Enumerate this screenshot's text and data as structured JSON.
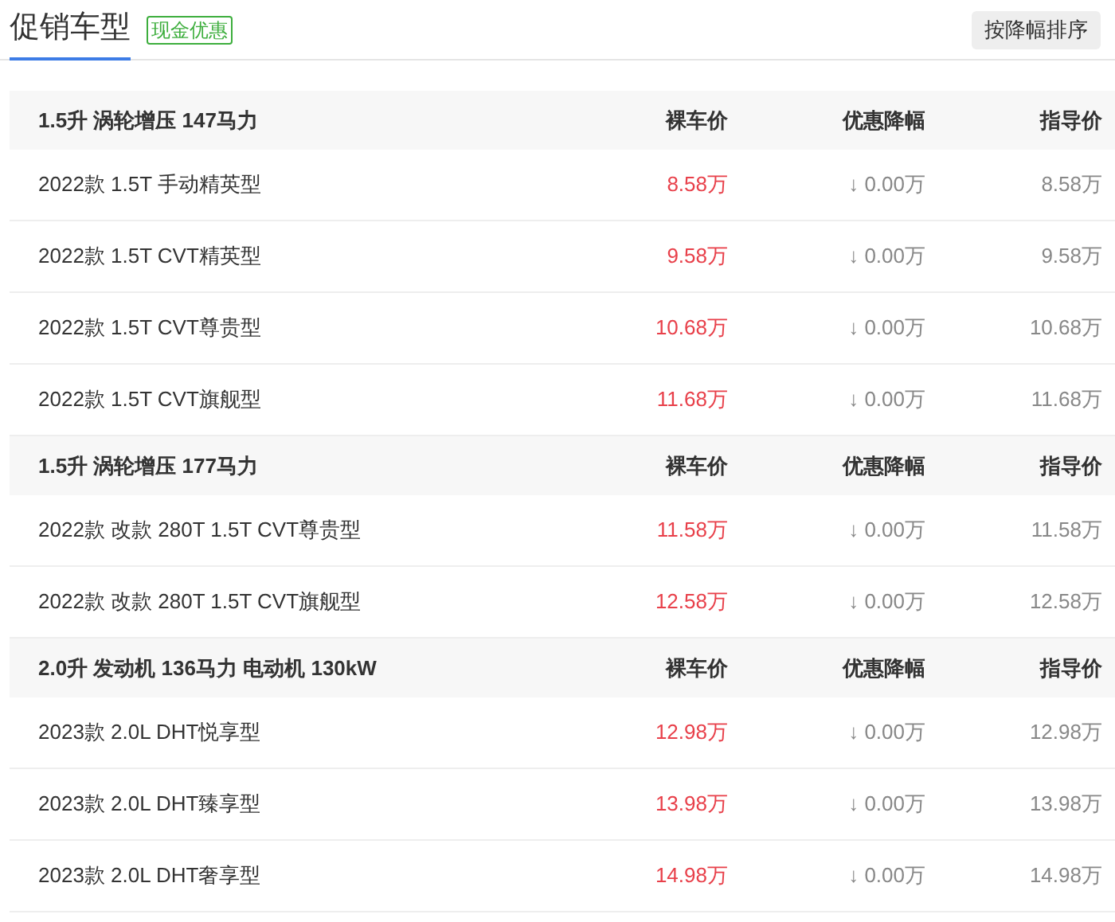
{
  "header": {
    "title": "促销车型",
    "badge": "现金优惠",
    "sort_button": "按降幅排序"
  },
  "groups": [
    {
      "name": "1.5升 涡轮增压 147马力",
      "columns": [
        "裸车价",
        "优惠降幅",
        "指导价"
      ],
      "rows": [
        {
          "name": "2022款 1.5T 手动精英型",
          "price": "8.58万",
          "discount": "↓ 0.00万",
          "msrp": "8.58万"
        },
        {
          "name": "2022款 1.5T CVT精英型",
          "price": "9.58万",
          "discount": "↓ 0.00万",
          "msrp": "9.58万"
        },
        {
          "name": "2022款 1.5T CVT尊贵型",
          "price": "10.68万",
          "discount": "↓ 0.00万",
          "msrp": "10.68万"
        },
        {
          "name": "2022款 1.5T CVT旗舰型",
          "price": "11.68万",
          "discount": "↓ 0.00万",
          "msrp": "11.68万"
        }
      ]
    },
    {
      "name": "1.5升 涡轮增压 177马力",
      "columns": [
        "裸车价",
        "优惠降幅",
        "指导价"
      ],
      "rows": [
        {
          "name": "2022款 改款 280T 1.5T CVT尊贵型",
          "price": "11.58万",
          "discount": "↓ 0.00万",
          "msrp": "11.58万"
        },
        {
          "name": "2022款 改款 280T 1.5T CVT旗舰型",
          "price": "12.58万",
          "discount": "↓ 0.00万",
          "msrp": "12.58万"
        }
      ]
    },
    {
      "name": "2.0升 发动机 136马力 电动机 130kW",
      "columns": [
        "裸车价",
        "优惠降幅",
        "指导价"
      ],
      "rows": [
        {
          "name": "2023款 2.0L DHT悦享型",
          "price": "12.98万",
          "discount": "↓ 0.00万",
          "msrp": "12.98万"
        },
        {
          "name": "2023款 2.0L DHT臻享型",
          "price": "13.98万",
          "discount": "↓ 0.00万",
          "msrp": "13.98万"
        },
        {
          "name": "2023款 2.0L DHT奢享型",
          "price": "14.98万",
          "discount": "↓ 0.00万",
          "msrp": "14.98万"
        }
      ]
    }
  ]
}
